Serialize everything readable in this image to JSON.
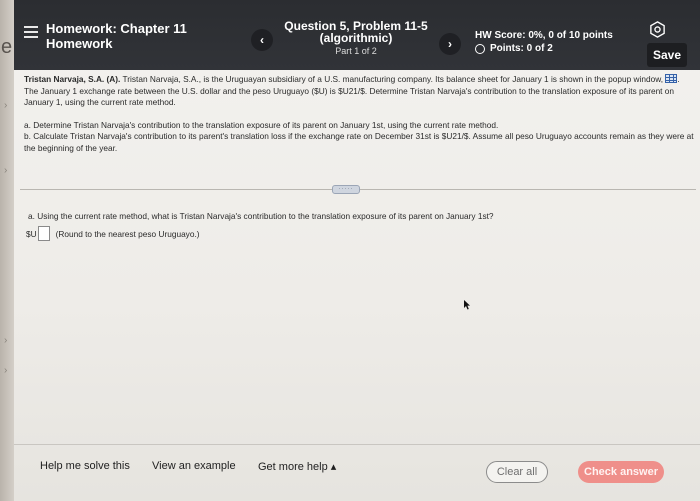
{
  "header": {
    "hw_title_prefix": "Homework: ",
    "hw_title_rest": "Chapter 11",
    "hw_subtitle": "Homework",
    "question_title": "Question 5, Problem 11-5",
    "question_sub": "(algorithmic)",
    "question_part": "Part 1 of 2",
    "score": "HW Score: 0%, 0 of 10 points",
    "points": "Points: 0 of 2",
    "save_label": "Save",
    "prev_glyph": "‹",
    "next_glyph": "›"
  },
  "frame": {
    "letter": "e"
  },
  "problem": {
    "intro_bold": "Tristan Narvaja, S.A. (A).",
    "intro_part1": " Tristan Narvaja, S.A., is the Uruguayan subsidiary of a U.S. manufacturing company. Its balance sheet for January 1 is shown in the popup window, ",
    "intro_part2": ". The January 1 exchange rate between the U.S. dollar and the peso Uruguayo ($U) is $U21/$. Determine Tristan Narvaja's contribution to the translation exposure of its parent on January 1, using the current rate method.",
    "item_a": "a. Determine Tristan Narvaja's contribution to the translation exposure of its parent on January 1st, using the current rate method.",
    "item_b": "b. Calculate Tristan Narvaja's contribution to its parent's translation loss if the exchange rate on December 31st is $U21/$. Assume all peso Uruguayo accounts remain as they were at the beginning of the year."
  },
  "expand_label": "·····",
  "question": {
    "text": "a. Using the current rate method, what is Tristan Narvaja's contribution to the translation exposure of its parent on January 1st?",
    "currency_prefix": "$U",
    "input_value": "",
    "hint": "(Round to the nearest peso Uruguayo.)"
  },
  "footer": {
    "help_label": "Help me solve this",
    "example_label": "View an example",
    "gethelp_label": "Get more help ▴",
    "clear_label": "Clear all",
    "check_label": "Check answer"
  },
  "icons": {
    "menu": "menu-icon",
    "gear": "gear-icon",
    "table": "table-icon",
    "circle": "circle-icon"
  },
  "colors": {
    "header_bg": "#2b2d31",
    "check_button": "#ef8f8a",
    "panel_bg": "#f3f2ef"
  }
}
